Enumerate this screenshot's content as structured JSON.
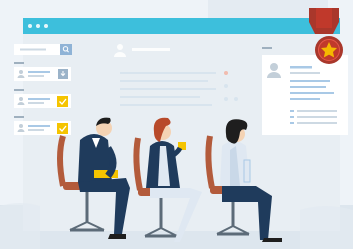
{
  "colors": {
    "background": "#eef3f8",
    "window_bar": "#3dbfdc",
    "window_body": "#e8eef3",
    "panel": "#ffffff",
    "line_light": "#cdd9e3",
    "line_blue": "#a9c9e6",
    "avatar": "#c3cfd9",
    "search_button": "#8fb3d6",
    "checkbox_yellow": "#f5c400",
    "download_badge": "#9bb3c9",
    "suit_navy": "#1f3b5c",
    "chair": "#b35b3b",
    "shirt_light": "#dfe8f2",
    "hair_red": "#b84a2a",
    "hair_black": "#1e1e1e",
    "skin": "#f4d3b4",
    "medal_red": "#c0392b",
    "medal_gold": "#f5b800",
    "floor": "#dde6ee"
  },
  "icons": {
    "search": "search-icon",
    "download": "download-icon",
    "check": "check-icon",
    "user": "user-icon",
    "medal": "medal-icon",
    "star": "star-icon"
  }
}
